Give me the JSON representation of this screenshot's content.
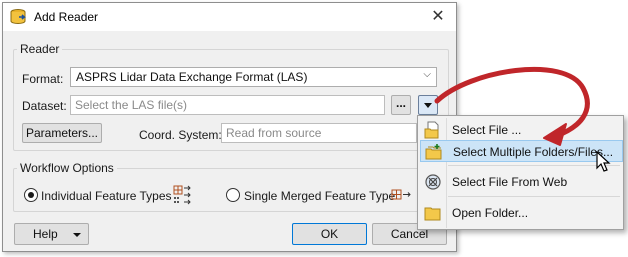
{
  "window": {
    "title": "Add Reader",
    "close_glyph": "✕"
  },
  "reader_group": {
    "label": "Reader",
    "format_label": "Format:",
    "format_value": "ASPRS Lidar Data Exchange Format (LAS)",
    "dataset_label": "Dataset:",
    "dataset_placeholder": "Select the LAS file(s)",
    "browse_label": "...",
    "parameters_label": "Parameters...",
    "coord_label": "Coord. System:",
    "coord_placeholder": "Read from source"
  },
  "workflow_group": {
    "label": "Workflow Options",
    "option_individual": "Individual Feature Types",
    "option_merged": "Single Merged Feature Type",
    "selected": "individual"
  },
  "footer": {
    "help_label": "Help",
    "ok_label": "OK",
    "cancel_label": "Cancel"
  },
  "menu": {
    "items": [
      {
        "label": "Select File ...",
        "icon": "file-folder-icon"
      },
      {
        "label": "Select Multiple Folders/Files...",
        "icon": "multi-folder-icon",
        "highlighted": true
      },
      {
        "label": "Select File From Web",
        "icon": "web-globe-icon"
      },
      {
        "label": "Open Folder...",
        "icon": "open-folder-icon"
      }
    ]
  },
  "colors": {
    "annotation_arrow": "#c0262a",
    "menu_highlight": "#cce4f7",
    "folder_yellow": "#f3c84a"
  }
}
